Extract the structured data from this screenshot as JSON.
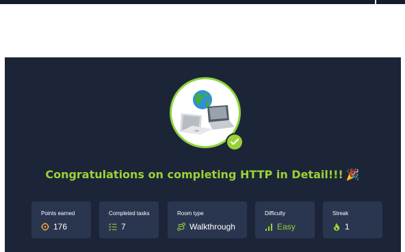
{
  "completion": {
    "title": "Congratulations on completing HTTP in Detail!!!",
    "emoji": "🎉"
  },
  "stats": [
    {
      "label": "Points earned",
      "value": "176",
      "icon": "target-icon",
      "icon_color": "#f0a63c"
    },
    {
      "label": "Completed tasks",
      "value": "7",
      "icon": "checklist-icon",
      "icon_color": "#9ad236"
    },
    {
      "label": "Room type",
      "value": "Walkthrough",
      "icon": "route-icon",
      "icon_color": "#9ad236"
    },
    {
      "label": "Difficulty",
      "value": "Easy",
      "icon": "signal-bars-icon",
      "icon_color": "#9ad236"
    },
    {
      "label": "Streak",
      "value": "1",
      "icon": "flame-icon",
      "icon_color": "#9ad236"
    }
  ],
  "colors": {
    "panel_background": "#1c2538",
    "card_background": "#2a3650",
    "accent": "#9ad236"
  }
}
